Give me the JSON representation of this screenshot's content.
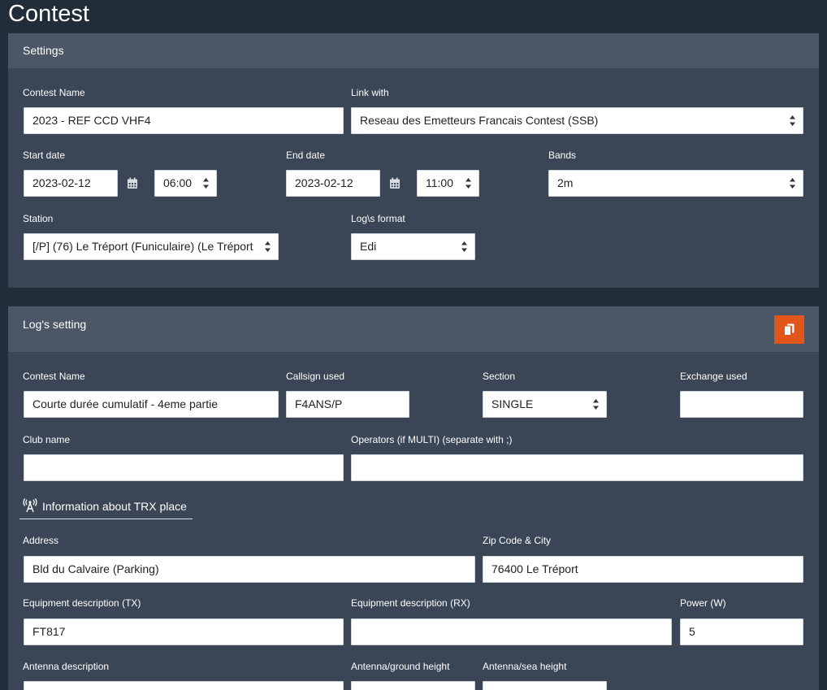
{
  "page": {
    "title": "Contest"
  },
  "settings": {
    "title": "Settings",
    "contest_name": {
      "label": "Contest Name",
      "value": "2023 - REF CCD VHF4"
    },
    "link_with": {
      "label": "Link with",
      "value": "Reseau des Emetteurs Francais Contest (SSB)"
    },
    "start": {
      "label": "Start date",
      "date": "2023-02-12",
      "time": "06:00"
    },
    "end": {
      "label": "End date",
      "date": "2023-02-12",
      "time": "11:00"
    },
    "bands": {
      "label": "Bands",
      "value": "2m"
    },
    "station": {
      "label": "Station",
      "value": "[/P] (76) Le Tréport (Funiculaire) (Le Tréport"
    },
    "log_format": {
      "label": "Log\\s format",
      "value": "Edi"
    }
  },
  "log_setting": {
    "title": "Log's setting",
    "contest_name": {
      "label": "Contest Name",
      "value": "Courte durée cumulatif - 4eme partie"
    },
    "callsign": {
      "label": "Callsign used",
      "value": "F4ANS/P"
    },
    "section": {
      "label": "Section",
      "value": "SINGLE"
    },
    "exchange": {
      "label": "Exchange used",
      "value": ""
    },
    "club": {
      "label": "Club name",
      "value": ""
    },
    "operators": {
      "label": "Operators (if MULTI) (separate with ;)",
      "value": ""
    },
    "trx_heading": "Information about TRX place",
    "address": {
      "label": "Address",
      "value": "Bld du Calvaire (Parking)"
    },
    "zip_city": {
      "label": "Zip Code & City",
      "value": "76400 Le Tréport"
    },
    "tx_equipment": {
      "label": "Equipment description (TX)",
      "value": "FT817"
    },
    "rx_equipment": {
      "label": "Equipment description (RX)",
      "value": ""
    },
    "power": {
      "label": "Power (W)",
      "value": "5"
    },
    "antenna": {
      "label": "Antenna description",
      "value": ""
    },
    "ground_height": {
      "label": "Antenna/ground height",
      "value": ""
    },
    "sea_height": {
      "label": "Antenna/sea height",
      "value": ""
    }
  },
  "icons": {
    "calendar": "calendar-icon",
    "select_arrows": "select-arrows-icon",
    "copy": "copy-icon",
    "antenna": "antenna-icon"
  },
  "colors": {
    "background": "#222d3a",
    "panel": "#3a4655",
    "panel_header": "#4b5766",
    "accent": "#e0561b"
  }
}
